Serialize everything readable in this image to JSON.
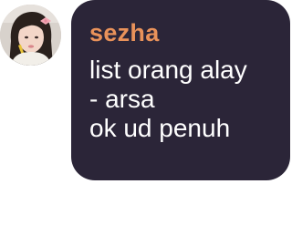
{
  "message": {
    "sender_name": "sezha",
    "lines": [
      "list orang alay",
      "- arsa",
      "ok ud penuh"
    ]
  },
  "avatar": {
    "description_icon": "profile-photo-icon"
  },
  "colors": {
    "bubble_background": "#2b2538",
    "sender_name": "#e9925a",
    "message_text": "#ffffff",
    "page_background": "#ffffff"
  }
}
